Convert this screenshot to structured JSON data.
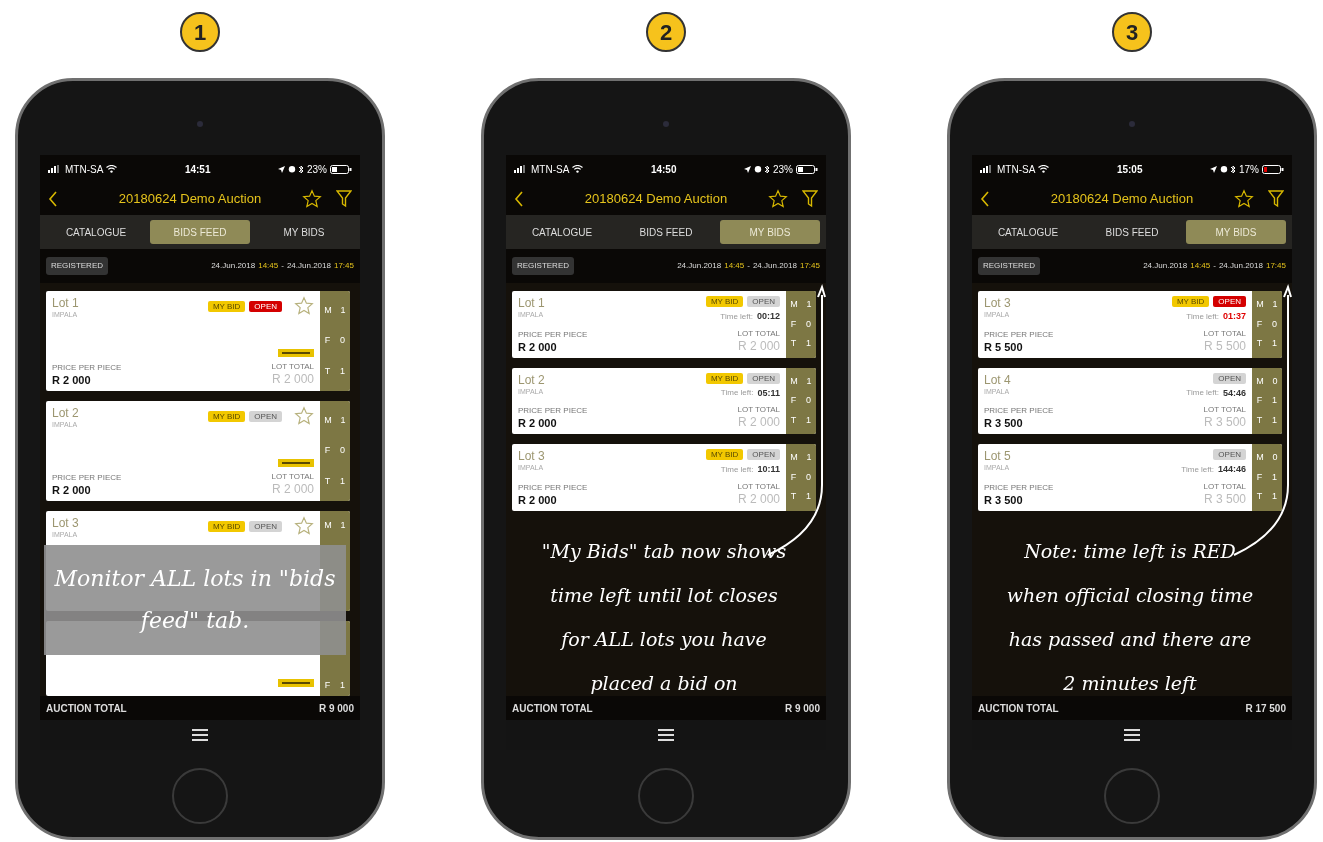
{
  "steps": [
    {
      "number": "1",
      "phone": {
        "status": {
          "carrier": "MTN-SA",
          "time": "14:51",
          "battery": "23%",
          "battery_low": false
        },
        "title": "20180624 Demo Auction",
        "tabs": [
          {
            "label": "CATALOGUE",
            "selected": false
          },
          {
            "label": "BIDS FEED",
            "selected": true
          },
          {
            "label": "MY BIDS",
            "selected": false
          }
        ],
        "registered": "REGISTERED",
        "start_date": "24.Jun.2018",
        "start_time": "14:45",
        "separator": "-",
        "end_date": "24.Jun.2018",
        "end_time": "17:45",
        "lots": [
          {
            "title": "Lot 1",
            "species": "IMPALA",
            "badges": [
              {
                "label": "MY BID",
                "kind": "mine"
              },
              {
                "label": "OPEN",
                "kind": "closing"
              }
            ],
            "starred": false,
            "logo": true,
            "price_label": "PRICE PER PIECE",
            "price": "R 2 000",
            "total_label": "LOT TOTAL",
            "total": "R 2 000",
            "side": [
              {
                "key": "M",
                "value": "1"
              },
              {
                "key": "F",
                "value": "0"
              },
              {
                "key": "T",
                "value": "1"
              }
            ]
          },
          {
            "title": "Lot 2",
            "species": "IMPALA",
            "badges": [
              {
                "label": "MY BID",
                "kind": "mine"
              },
              {
                "label": "OPEN",
                "kind": "status"
              }
            ],
            "starred": false,
            "logo": true,
            "price_label": "PRICE PER PIECE",
            "price": "R 2 000",
            "total_label": "LOT TOTAL",
            "total": "R 2 000",
            "side": [
              {
                "key": "M",
                "value": "1"
              },
              {
                "key": "F",
                "value": "0"
              },
              {
                "key": "T",
                "value": "1"
              }
            ]
          },
          {
            "title": "Lot 3",
            "species": "IMPALA",
            "badges": [
              {
                "label": "MY BID",
                "kind": "mine"
              },
              {
                "label": "OPEN",
                "kind": "status"
              }
            ],
            "starred": false,
            "logo": false,
            "side": [
              {
                "key": "M",
                "value": "1"
              }
            ]
          },
          {
            "logo": true,
            "side": [
              {
                "key": "F",
                "value": "1"
              }
            ]
          }
        ],
        "total_label": "AUCTION TOTAL",
        "total": "R 9 000"
      },
      "annotation": {
        "kind": "overlay",
        "text": "Monitor ALL lots in \"bids feed\" tab."
      }
    },
    {
      "number": "2",
      "phone": {
        "status": {
          "carrier": "MTN-SA",
          "time": "14:50",
          "battery": "23%",
          "battery_low": false
        },
        "title": "20180624 Demo Auction",
        "tabs": [
          {
            "label": "CATALOGUE",
            "selected": false
          },
          {
            "label": "BIDS FEED",
            "selected": false
          },
          {
            "label": "MY BIDS",
            "selected": true
          }
        ],
        "registered": "REGISTERED",
        "start_date": "24.Jun.2018",
        "start_time": "14:45",
        "separator": "-",
        "end_date": "24.Jun.2018",
        "end_time": "17:45",
        "lots": [
          {
            "title": "Lot 1",
            "species": "IMPALA",
            "badges": [
              {
                "label": "MY BID",
                "kind": "mine"
              },
              {
                "label": "OPEN",
                "kind": "status"
              }
            ],
            "time_label": "Time left:",
            "time_left": "00:12",
            "time_urgent": false,
            "price_label": "PRICE PER PIECE",
            "price": "R 2 000",
            "total_label": "LOT TOTAL",
            "total": "R 2 000",
            "side": [
              {
                "key": "M",
                "value": "1"
              },
              {
                "key": "F",
                "value": "0"
              },
              {
                "key": "T",
                "value": "1"
              }
            ]
          },
          {
            "title": "Lot 2",
            "species": "IMPALA",
            "badges": [
              {
                "label": "MY BID",
                "kind": "mine"
              },
              {
                "label": "OPEN",
                "kind": "status"
              }
            ],
            "time_label": "Time left:",
            "time_left": "05:11",
            "time_urgent": false,
            "price_label": "PRICE PER PIECE",
            "price": "R 2 000",
            "total_label": "LOT TOTAL",
            "total": "R 2 000",
            "side": [
              {
                "key": "M",
                "value": "1"
              },
              {
                "key": "F",
                "value": "0"
              },
              {
                "key": "T",
                "value": "1"
              }
            ]
          },
          {
            "title": "Lot 3",
            "species": "IMPALA",
            "badges": [
              {
                "label": "MY BID",
                "kind": "mine"
              },
              {
                "label": "OPEN",
                "kind": "status"
              }
            ],
            "time_label": "Time left:",
            "time_left": "10:11",
            "time_urgent": false,
            "price_label": "PRICE PER PIECE",
            "price": "R 2 000",
            "total_label": "LOT TOTAL",
            "total": "R 2 000",
            "side": [
              {
                "key": "M",
                "value": "1"
              },
              {
                "key": "F",
                "value": "0"
              },
              {
                "key": "T",
                "value": "1"
              }
            ]
          }
        ],
        "total_label": "AUCTION TOTAL",
        "total": "R 9 000"
      },
      "annotation": {
        "kind": "caption",
        "text": "\"My Bids\" tab now shows time left until lot closes for ALL lots you have placed a bid on"
      }
    },
    {
      "number": "3",
      "phone": {
        "status": {
          "carrier": "MTN-SA",
          "time": "15:05",
          "battery": "17%",
          "battery_low": true
        },
        "title": "20180624 Demo Auction",
        "tabs": [
          {
            "label": "CATALOGUE",
            "selected": false
          },
          {
            "label": "BIDS FEED",
            "selected": false
          },
          {
            "label": "MY BIDS",
            "selected": true
          }
        ],
        "registered": "REGISTERED",
        "start_date": "24.Jun.2018",
        "start_time": "14:45",
        "separator": "-",
        "end_date": "24.Jun.2018",
        "end_time": "17:45",
        "lots": [
          {
            "title": "Lot 3",
            "species": "IMPALA",
            "badges": [
              {
                "label": "MY BID",
                "kind": "mine"
              },
              {
                "label": "OPEN",
                "kind": "closing"
              }
            ],
            "time_label": "Time left:",
            "time_left": "01:37",
            "time_urgent": true,
            "price_label": "PRICE PER PIECE",
            "price": "R 5 500",
            "total_label": "LOT TOTAL",
            "total": "R 5 500",
            "side": [
              {
                "key": "M",
                "value": "1"
              },
              {
                "key": "F",
                "value": "0"
              },
              {
                "key": "T",
                "value": "1"
              }
            ]
          },
          {
            "title": "Lot 4",
            "species": "IMPALA",
            "badges": [
              {
                "label": "OPEN",
                "kind": "status"
              }
            ],
            "time_label": "Time left:",
            "time_left": "54:46",
            "time_urgent": false,
            "price_label": "PRICE PER PIECE",
            "price": "R 3 500",
            "total_label": "LOT TOTAL",
            "total": "R 3 500",
            "side": [
              {
                "key": "M",
                "value": "0"
              },
              {
                "key": "F",
                "value": "1"
              },
              {
                "key": "T",
                "value": "1"
              }
            ]
          },
          {
            "title": "Lot 5",
            "species": "IMPALA",
            "badges": [
              {
                "label": "OPEN",
                "kind": "status"
              }
            ],
            "time_label": "Time left:",
            "time_left": "144:46",
            "time_urgent": false,
            "price_label": "PRICE PER PIECE",
            "price": "R 3 500",
            "total_label": "LOT TOTAL",
            "total": "R 3 500",
            "side": [
              {
                "key": "M",
                "value": "0"
              },
              {
                "key": "F",
                "value": "1"
              },
              {
                "key": "T",
                "value": "1"
              }
            ]
          }
        ],
        "total_label": "AUCTION TOTAL",
        "total": "R 17 500"
      },
      "annotation": {
        "kind": "caption",
        "text": "Note: time left is RED when official closing time has passed and there are 2 minutes left"
      }
    }
  ]
}
